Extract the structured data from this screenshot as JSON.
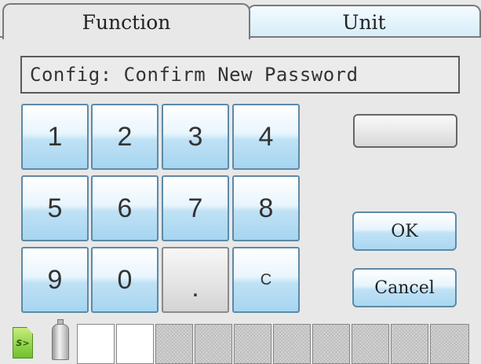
{
  "tabs": {
    "function": "Function",
    "unit": "Unit"
  },
  "display": {
    "text": "Config: Confirm New Password"
  },
  "keypad": {
    "k1": "1",
    "k2": "2",
    "k3": "3",
    "k4": "4",
    "k5": "5",
    "k6": "6",
    "k7": "7",
    "k8": "8",
    "k9": "9",
    "k0": "0",
    "kdot": ".",
    "kclear": "C"
  },
  "buttons": {
    "blank": "",
    "ok": "OK",
    "cancel": "Cancel"
  },
  "status": {
    "sd_label": "S>",
    "slots": [
      "empty",
      "empty",
      "unavailable",
      "unavailable",
      "unavailable",
      "unavailable",
      "unavailable",
      "unavailable",
      "unavailable",
      "unavailable"
    ]
  },
  "colors": {
    "key_blue": "#a6d5f0",
    "key_border": "#5d8aa8",
    "sd_green": "#6fc02c"
  }
}
